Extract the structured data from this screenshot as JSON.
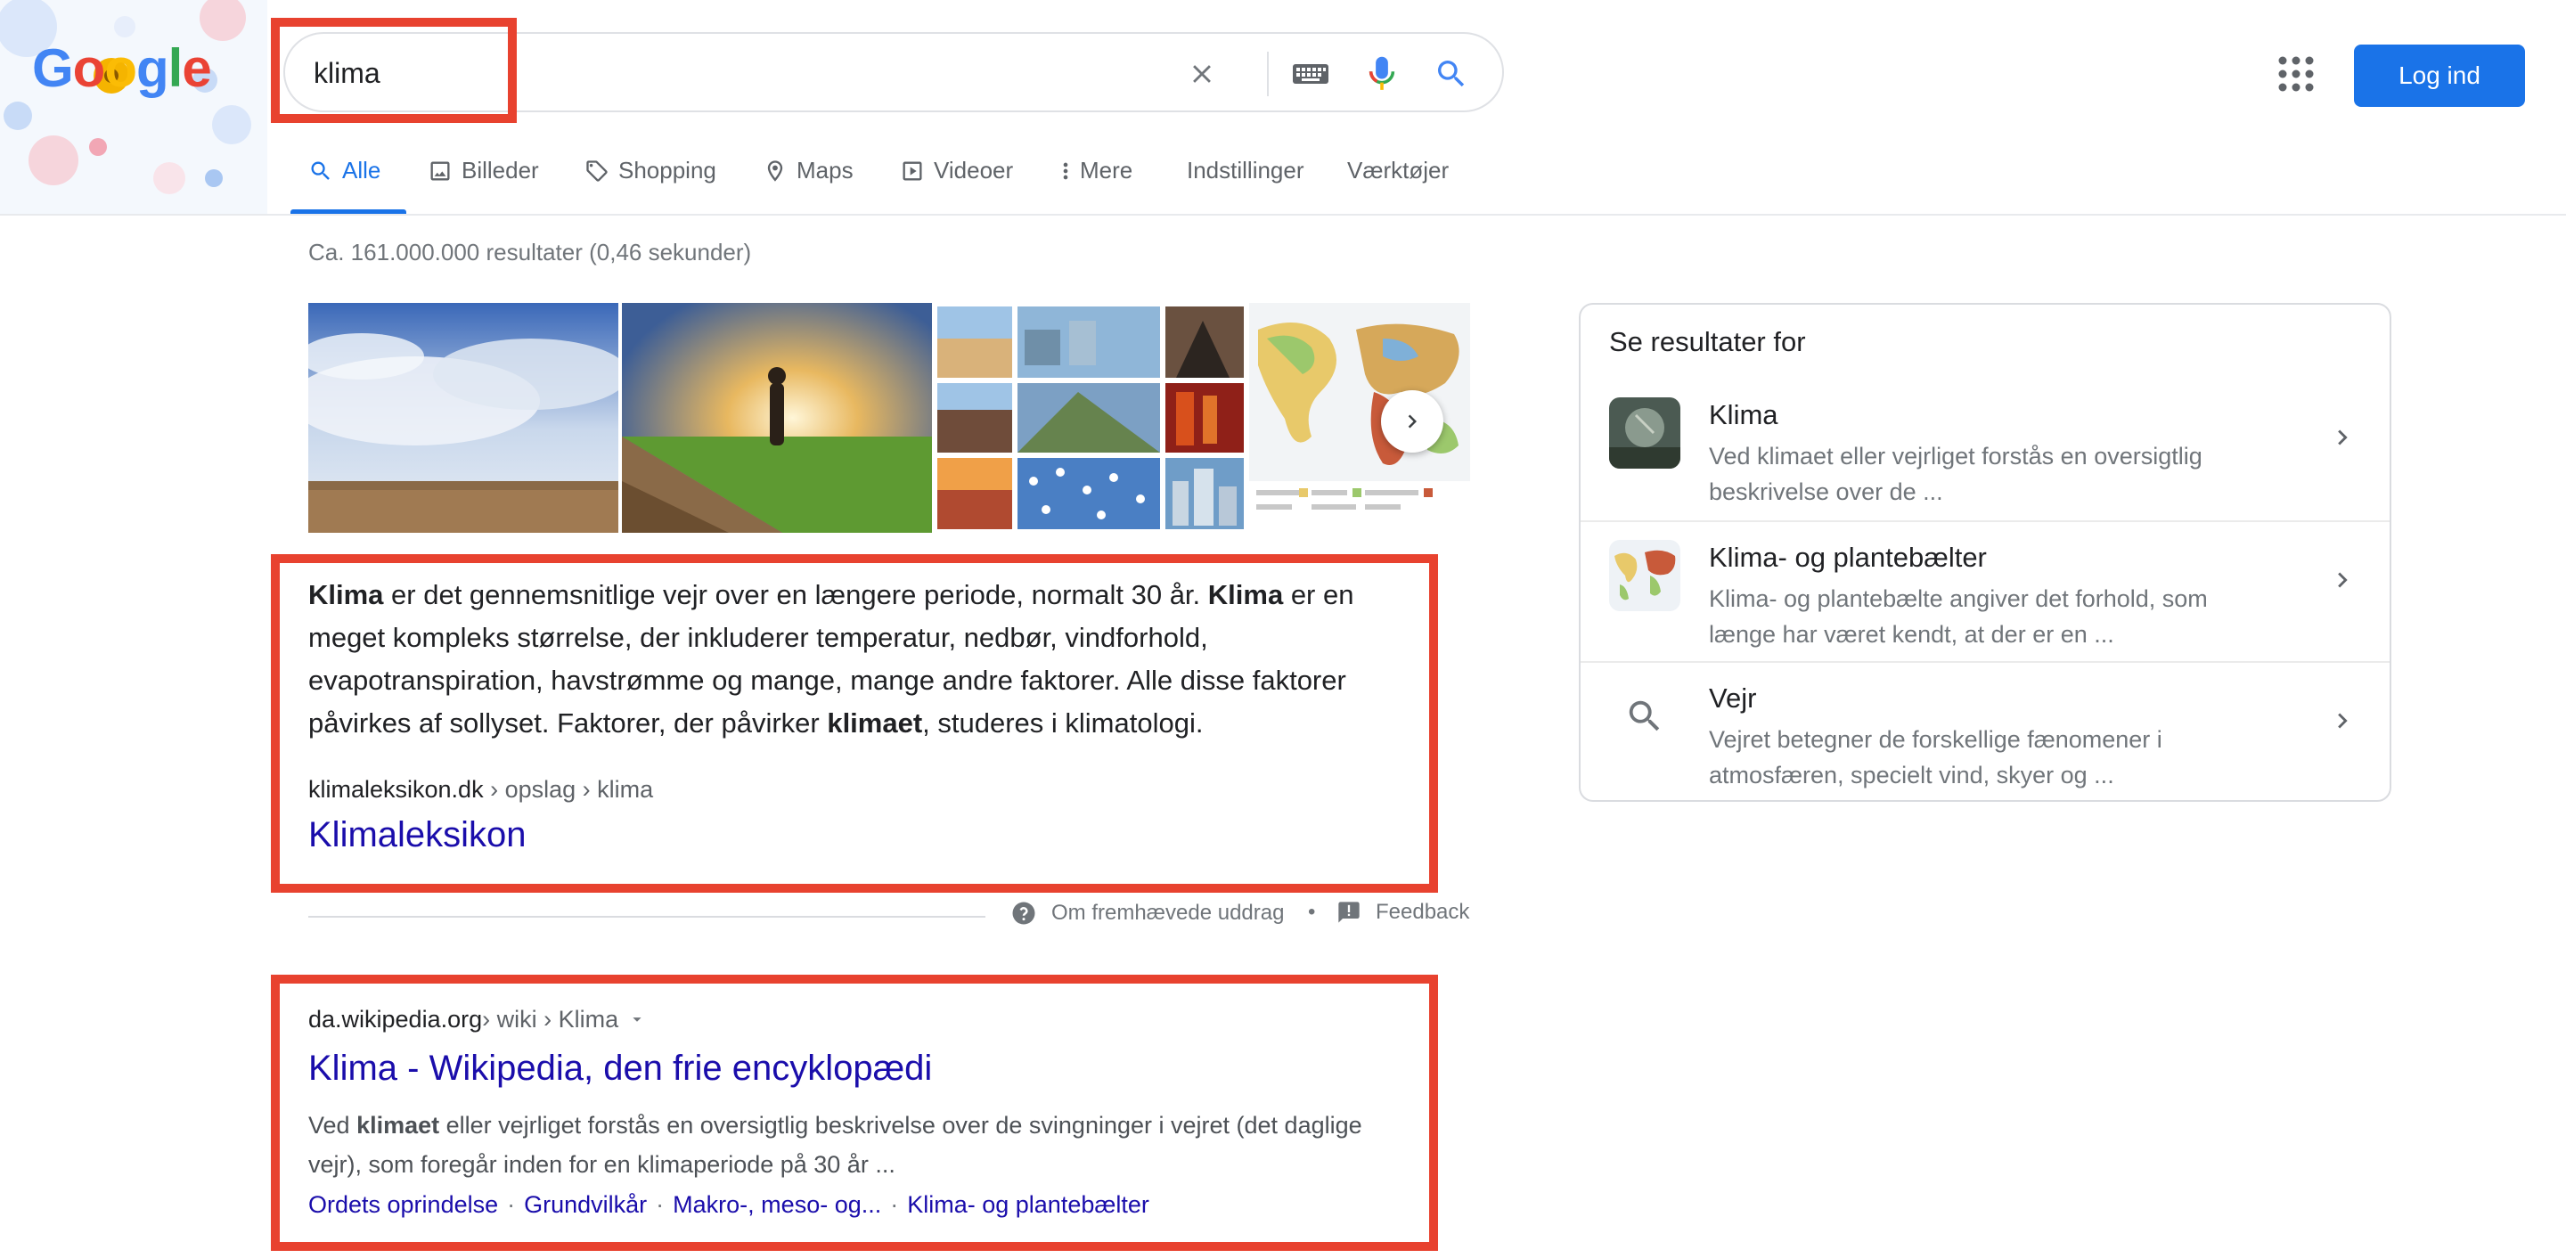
{
  "header": {
    "logo_text": "Google",
    "search": {
      "value": "klima"
    },
    "login_label": "Log ind"
  },
  "tabs": [
    {
      "label": "Alle",
      "icon": "search-icon"
    },
    {
      "label": "Billeder",
      "icon": "image-icon"
    },
    {
      "label": "Shopping",
      "icon": "tag-icon"
    },
    {
      "label": "Maps",
      "icon": "map-pin-icon"
    },
    {
      "label": "Videoer",
      "icon": "video-icon"
    },
    {
      "label": "Mere",
      "icon": "more-vert-icon"
    },
    {
      "label": "Indstillinger"
    },
    {
      "label": "Værktøjer"
    }
  ],
  "stats": "Ca. 161.000.000 resultater (0,46 sekunder)",
  "featured": {
    "text": [
      {
        "t": "Klima",
        "b": true
      },
      {
        "t": " er det gennemsnitlige vejr over en længere periode, normalt 30 år. "
      },
      {
        "t": "Klima",
        "b": true
      },
      {
        "t": " er en meget kompleks størrelse, der inkluderer temperatur, nedbør, vindforhold, evapotranspiration, havstrømme og mange, mange andre faktorer. Alle disse faktorer påvirkes af sollyset. Faktorer, der påvirker "
      },
      {
        "t": "klimaet",
        "b": true
      },
      {
        "t": ", studeres i klimatologi."
      }
    ],
    "cite_domain": "klimaleksikon.dk",
    "cite_path": " › opslag › klima",
    "title": "Klimaleksikon",
    "footer_about": "Om fremhævede uddrag",
    "footer_sep": "•",
    "footer_feedback": "Feedback"
  },
  "result": {
    "cite_domain": "da.wikipedia.org",
    "cite_path": " › wiki › Klima",
    "title": "Klima - Wikipedia, den frie encyklopædi",
    "desc": [
      {
        "t": "Ved "
      },
      {
        "t": "klimaet",
        "b": true
      },
      {
        "t": " eller vejrliget forstås en oversigtlig beskrivelse over de svingninger i vejret (det daglige vejr), som foregår inden for en klimaperiode på 30 år ..."
      }
    ],
    "sitelinks": [
      "Ordets oprindelse",
      "Grundvilkår",
      "Makro-, meso- og...",
      "Klima- og plantebælter"
    ],
    "sitelink_sep": "·"
  },
  "panel": {
    "title": "Se resultater for",
    "items": [
      {
        "name": "Klima",
        "desc": "Ved klimaet eller vejrliget forstås en oversigtlig beskrivelse over de ..."
      },
      {
        "name": "Klima- og plantebælter",
        "desc": "Klima- og plantebælte angiver det forhold, som længe har været kendt, at der er en ..."
      },
      {
        "name": "Vejr",
        "desc": "Vejret betegner de forskellige fænomener i atmosfæren, specielt vind, skyer og ..."
      }
    ]
  },
  "colors": {
    "link": "#1a0dab",
    "accent": "#1a73e8",
    "highlight": "#e8422f"
  }
}
